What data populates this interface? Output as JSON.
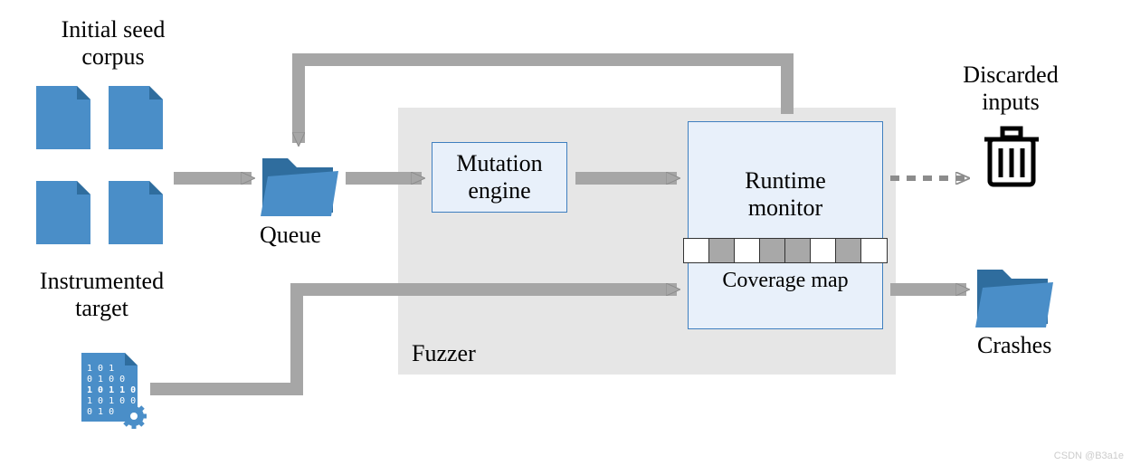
{
  "labels": {
    "initial_seed": "Initial seed\ncorpus",
    "instrumented": "Instrumented\ntarget",
    "queue": "Queue",
    "mutation": "Mutation\nengine",
    "runtime": "Runtime\nmonitor",
    "coverage": "Coverage map",
    "fuzzer": "Fuzzer",
    "discarded": "Discarded\ninputs",
    "crashes": "Crashes"
  },
  "coverage_map_cells": [
    "w",
    "g",
    "w",
    "g",
    "g",
    "w",
    "g",
    "w"
  ],
  "colors": {
    "fill_blue": "#4a8ec8",
    "dark_blue": "#2f6d9e",
    "arrow": "#a6a6a6",
    "arrow_stroke": "#8c8c8c",
    "box_bg": "#e8f0fa",
    "box_border": "#3f7fbf",
    "region_bg": "#e6e6e6"
  },
  "watermark": "CSDN @B3a1e"
}
